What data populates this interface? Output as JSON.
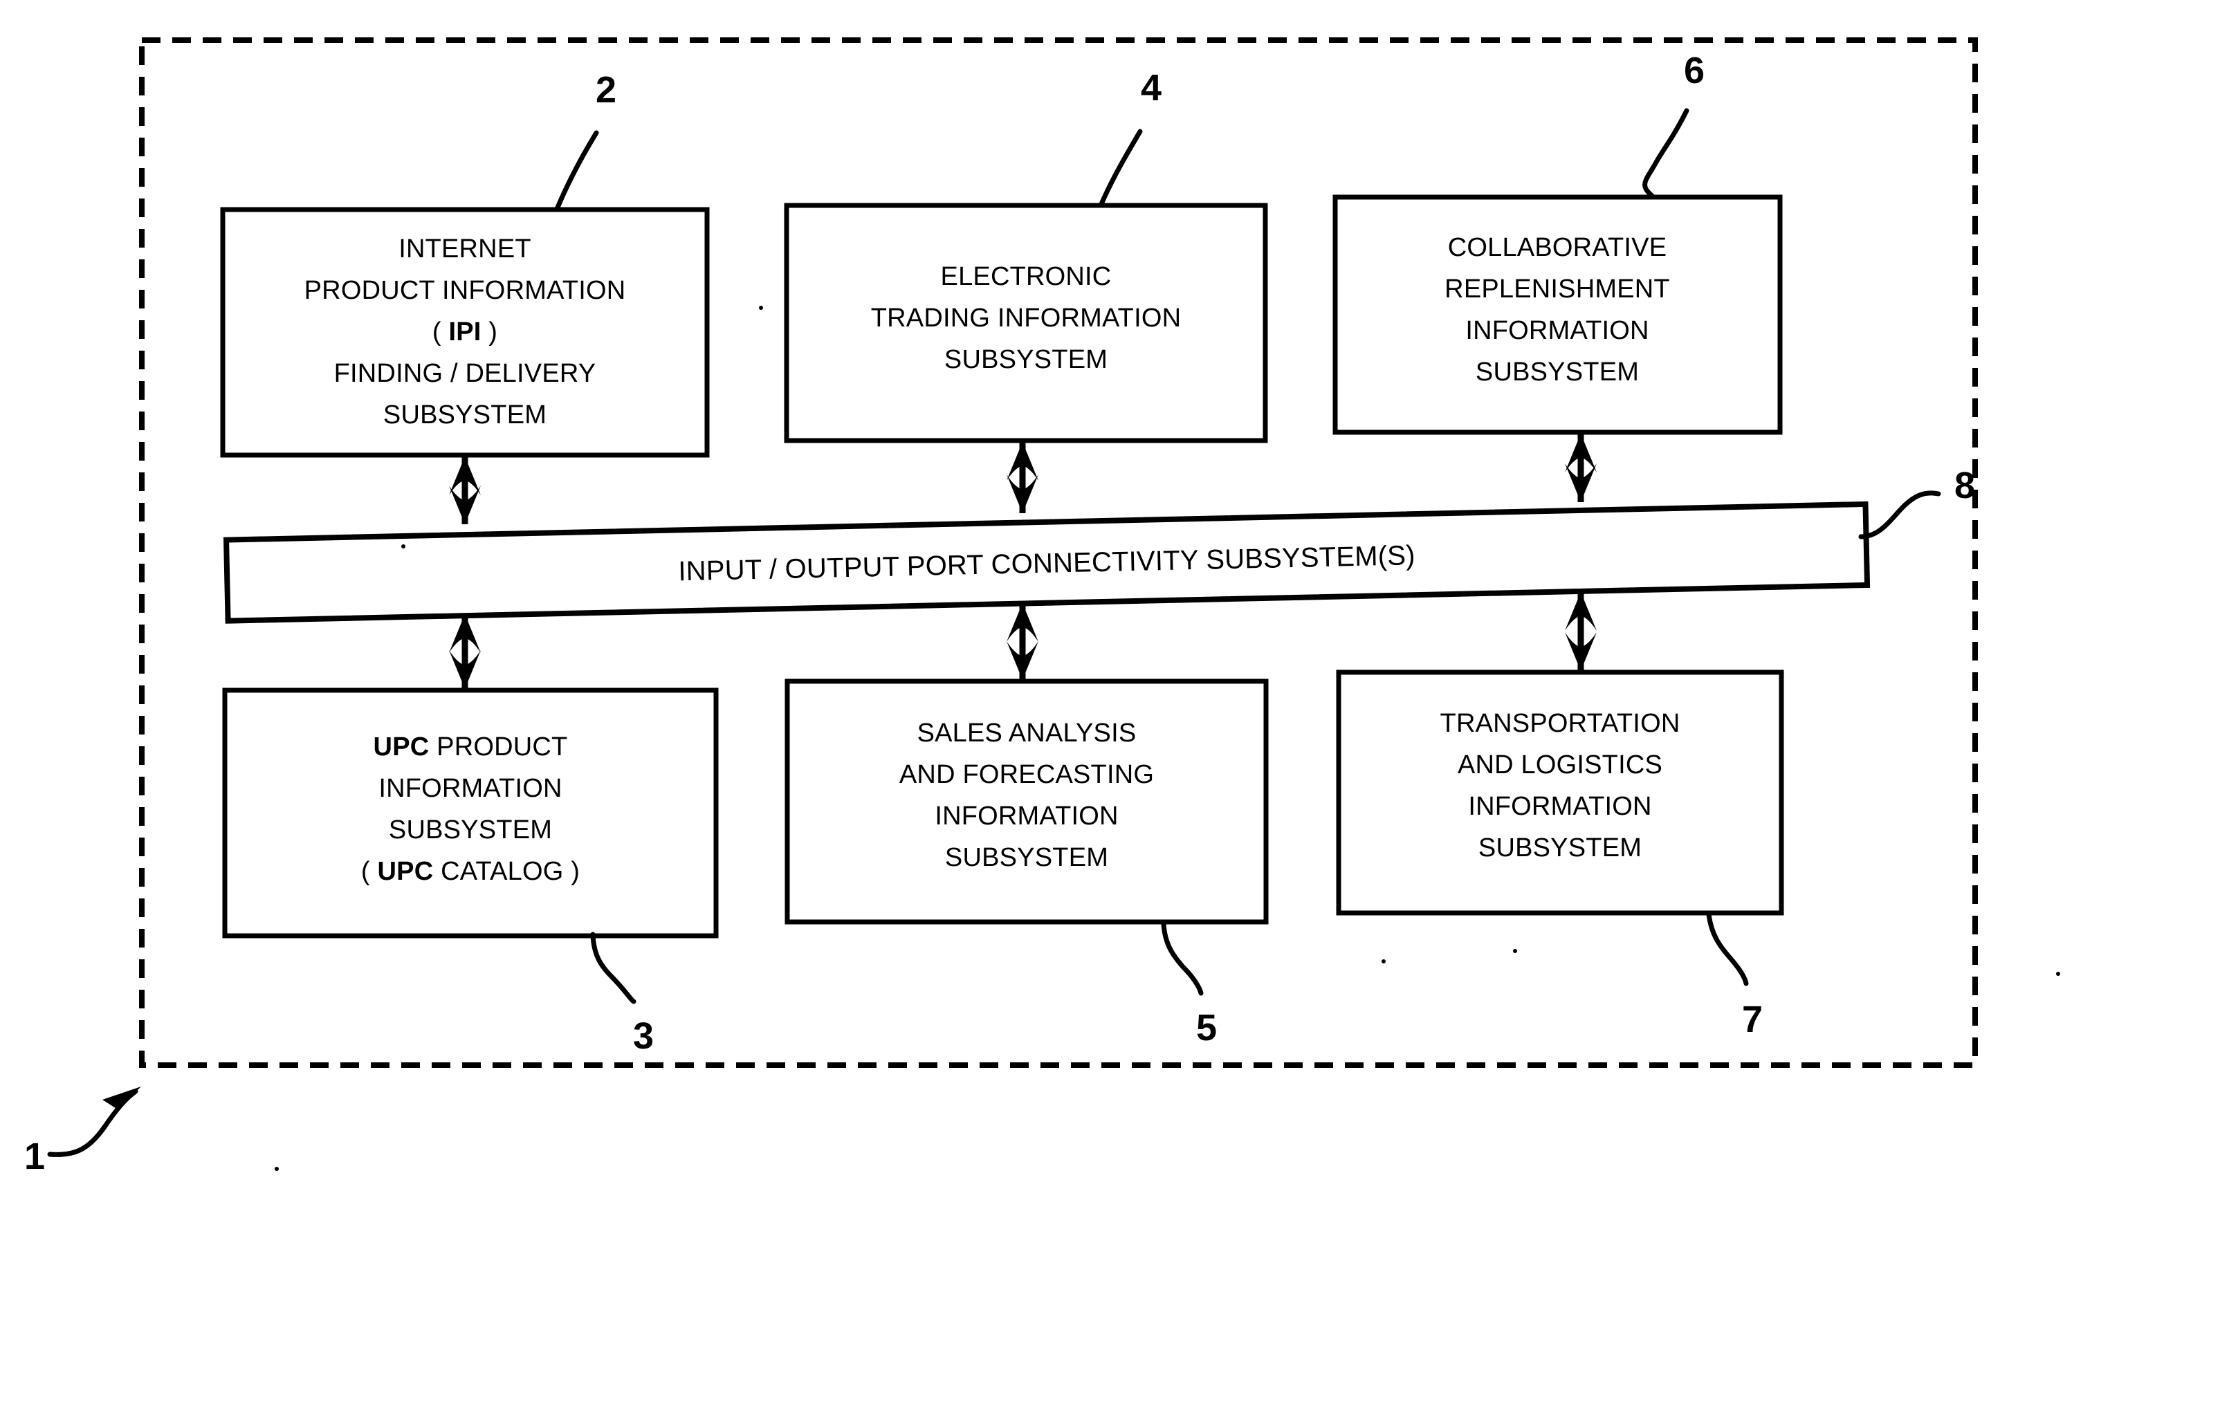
{
  "figure": {
    "title": "Patent figure: supply chain information subsystems block diagram",
    "boundary_label": "1",
    "stroke_color": "#000000",
    "background_color": "#ffffff"
  },
  "boxes": {
    "internet_ipi": {
      "ref": "2",
      "lines": [
        {
          "text": "INTERNET",
          "bold": false
        },
        {
          "text": "PRODUCT INFORMATION",
          "bold": false
        },
        {
          "text": "( IPI )",
          "bold_token": "IPI"
        },
        {
          "text": "FINDING / DELIVERY",
          "bold": false
        },
        {
          "text": "SUBSYSTEM",
          "bold": false
        }
      ]
    },
    "electronic_trading": {
      "ref": "4",
      "lines": [
        {
          "text": "ELECTRONIC",
          "bold": false
        },
        {
          "text": "TRADING INFORMATION",
          "bold": false
        },
        {
          "text": "SUBSYSTEM",
          "bold": false
        }
      ]
    },
    "collaborative_replenishment": {
      "ref": "6",
      "lines": [
        {
          "text": "COLLABORATIVE",
          "bold": false
        },
        {
          "text": "REPLENISHMENT",
          "bold": false
        },
        {
          "text": "INFORMATION",
          "bold": false
        },
        {
          "text": "SUBSYSTEM",
          "bold": false
        }
      ]
    },
    "io_port_bar": {
      "ref": "8",
      "lines": [
        {
          "text": "INPUT / OUTPUT PORT CONNECTIVITY SUBSYSTEM(S)",
          "bold": false
        }
      ]
    },
    "upc_product": {
      "ref": "3",
      "lines": [
        {
          "text": "UPC PRODUCT",
          "bold_token": "UPC"
        },
        {
          "text": "INFORMATION",
          "bold": false
        },
        {
          "text": "SUBSYSTEM",
          "bold": false
        },
        {
          "text": "( UPC CATALOG )",
          "bold_token": "UPC"
        }
      ]
    },
    "sales_analysis": {
      "ref": "5",
      "lines": [
        {
          "text": "SALES ANALYSIS",
          "bold": false
        },
        {
          "text": "AND FORECASTING",
          "bold": false
        },
        {
          "text": "INFORMATION",
          "bold": false
        },
        {
          "text": "SUBSYSTEM",
          "bold": false
        }
      ]
    },
    "transportation_logistics": {
      "ref": "7",
      "lines": [
        {
          "text": "TRANSPORTATION",
          "bold": false
        },
        {
          "text": "AND LOGISTICS",
          "bold": false
        },
        {
          "text": "INFORMATION",
          "bold": false
        },
        {
          "text": "SUBSYSTEM",
          "bold": false
        }
      ]
    }
  },
  "text": {
    "internet_l1": "INTERNET",
    "internet_l2": "PRODUCT INFORMATION",
    "internet_l3_open": "( ",
    "internet_l3_bold": "IPI",
    "internet_l3_close": " )",
    "internet_l4": "FINDING / DELIVERY",
    "internet_l5": "SUBSYSTEM",
    "electronic_l1": "ELECTRONIC",
    "electronic_l2": "TRADING INFORMATION",
    "electronic_l3": "SUBSYSTEM",
    "collab_l1": "COLLABORATIVE",
    "collab_l2": "REPLENISHMENT",
    "collab_l3": "INFORMATION",
    "collab_l4": "SUBSYSTEM",
    "bar_label": "INPUT / OUTPUT PORT CONNECTIVITY SUBSYSTEM(S)",
    "upc_l1_bold": "UPC",
    "upc_l1_rest": " PRODUCT",
    "upc_l2": "INFORMATION",
    "upc_l3": "SUBSYSTEM",
    "upc_l4_open": "( ",
    "upc_l4_bold": "UPC",
    "upc_l4_close": " CATALOG )",
    "sales_l1": "SALES ANALYSIS",
    "sales_l2": "AND FORECASTING",
    "sales_l3": "INFORMATION",
    "sales_l4": "SUBSYSTEM",
    "transport_l1": "TRANSPORTATION",
    "transport_l2": "AND LOGISTICS",
    "transport_l3": "INFORMATION",
    "transport_l4": "SUBSYSTEM"
  },
  "ref_numerals": {
    "n1": "1",
    "n2": "2",
    "n3": "3",
    "n4": "4",
    "n5": "5",
    "n6": "6",
    "n7": "7",
    "n8": "8"
  },
  "connections": [
    {
      "from": "internet_ipi",
      "to": "io_port_bar",
      "type": "double-arrow"
    },
    {
      "from": "electronic_trading",
      "to": "io_port_bar",
      "type": "double-arrow"
    },
    {
      "from": "collaborative_replenishment",
      "to": "io_port_bar",
      "type": "double-arrow"
    },
    {
      "from": "io_port_bar",
      "to": "upc_product",
      "type": "double-arrow"
    },
    {
      "from": "io_port_bar",
      "to": "sales_analysis",
      "type": "double-arrow"
    },
    {
      "from": "io_port_bar",
      "to": "transportation_logistics",
      "type": "double-arrow"
    }
  ]
}
